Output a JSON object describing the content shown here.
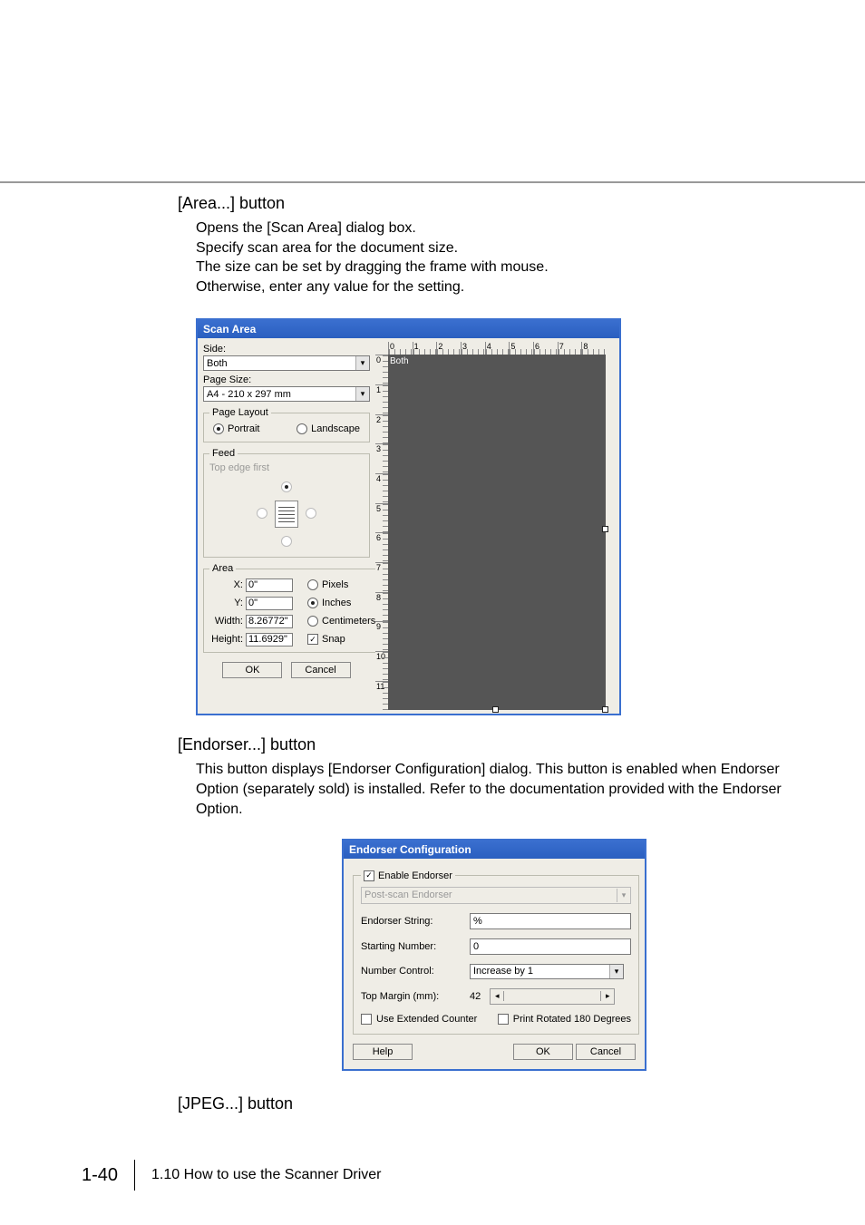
{
  "sections": {
    "area_button_title": "[Area...] button",
    "area_button_body": [
      "Opens the [Scan Area] dialog box.",
      "Specify scan area for the document size.",
      "The size can be set by dragging the frame with mouse.",
      "Otherwise, enter any value for the setting."
    ],
    "endorser_button_title": "[Endorser...] button",
    "endorser_button_body": "This button displays [Endorser Configuration] dialog. This button is enabled when Endorser Option (separately sold) is installed. Refer to the documentation provided with the Endorser Option.",
    "jpeg_button_title": "[JPEG...] button"
  },
  "scan_area_dialog": {
    "title": "Scan Area",
    "side_label": "Side:",
    "side_value": "Both",
    "page_size_label": "Page Size:",
    "page_size_value": "A4 - 210 x 297 mm",
    "page_layout": {
      "legend": "Page Layout",
      "portrait": "Portrait",
      "landscape": "Landscape"
    },
    "feed": {
      "legend": "Feed",
      "subtitle": "Top edge first"
    },
    "area": {
      "legend": "Area",
      "x_label": "X:",
      "x_value": "0\"",
      "y_label": "Y:",
      "y_value": "0\"",
      "width_label": "Width:",
      "width_value": "8.26772\"",
      "height_label": "Height:",
      "height_value": "11.6929\"",
      "unit_pixels": "Pixels",
      "unit_inches": "Inches",
      "unit_cm": "Centimeters",
      "snap_label": "Snap"
    },
    "buttons": {
      "ok": "OK",
      "cancel": "Cancel"
    },
    "ruler_h": [
      "0",
      "1",
      "2",
      "3",
      "4",
      "5",
      "6",
      "7",
      "8"
    ],
    "ruler_v": [
      "0",
      "1",
      "2",
      "3",
      "4",
      "5",
      "6",
      "7",
      "8",
      "9",
      "10",
      "11"
    ],
    "preview_tag": "Both"
  },
  "endorser_dialog": {
    "title": "Endorser Configuration",
    "enable_label": "Enable Endorser",
    "mode_value": "Post-scan Endorser",
    "string_label": "Endorser String:",
    "string_value": "%",
    "start_label": "Starting Number:",
    "start_value": "0",
    "number_control_label": "Number Control:",
    "number_control_value": "Increase by 1",
    "top_margin_label": "Top Margin (mm):",
    "top_margin_value": "42",
    "use_extended_label": "Use Extended Counter",
    "print_rotated_label": "Print Rotated 180 Degrees",
    "buttons": {
      "help": "Help",
      "ok": "OK",
      "cancel": "Cancel"
    }
  },
  "footer": {
    "page_number": "1-40",
    "section_text": "1.10 How to use the Scanner Driver"
  }
}
